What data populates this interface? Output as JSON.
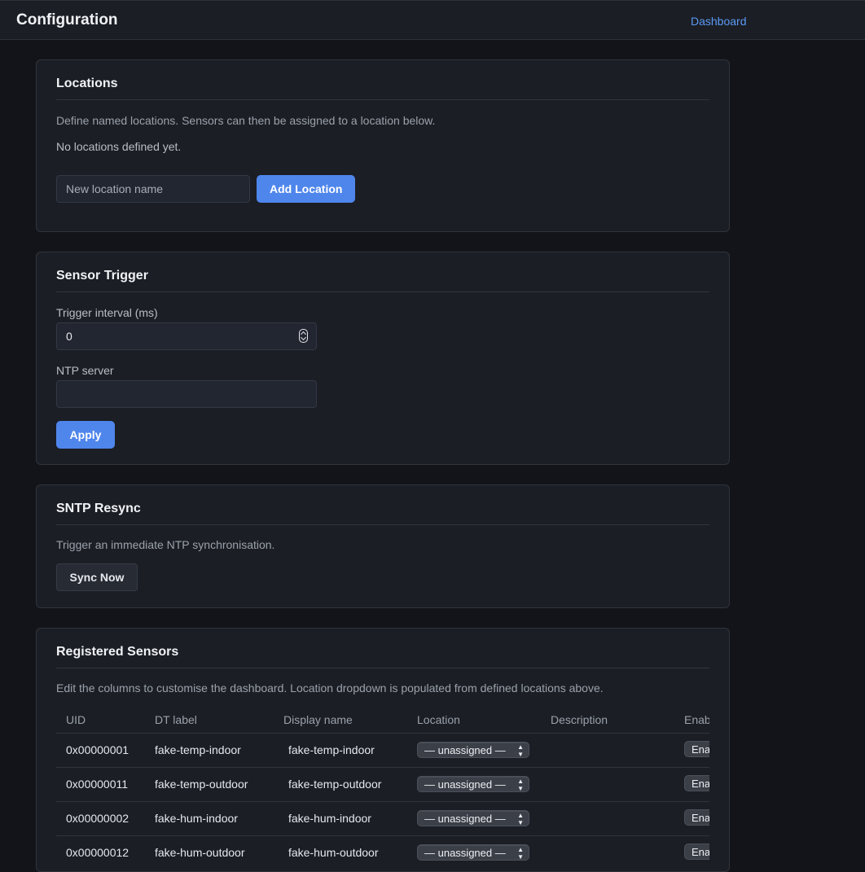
{
  "header": {
    "title": "Configuration",
    "nav_link": "Dashboard"
  },
  "locations": {
    "title": "Locations",
    "description": "Define named locations. Sensors can then be assigned to a location below.",
    "empty_text": "No locations defined yet.",
    "input_placeholder": "New location name",
    "add_button": "Add Location"
  },
  "sensor_trigger": {
    "title": "Sensor Trigger",
    "interval_label": "Trigger interval (ms)",
    "interval_value": "0",
    "ntp_label": "NTP server",
    "ntp_value": "",
    "apply_button": "Apply"
  },
  "sntp": {
    "title": "SNTP Resync",
    "description": "Trigger an immediate NTP synchronisation.",
    "sync_button": "Sync Now"
  },
  "sensors": {
    "title": "Registered Sensors",
    "description": "Edit the columns to customise the dashboard. Location dropdown is populated from defined locations above.",
    "columns": [
      "UID",
      "DT label",
      "Display name",
      "Location",
      "Description",
      "Enab"
    ],
    "rows": [
      {
        "uid": "0x00000001",
        "dt_label": "fake-temp-indoor",
        "display_name": "fake-temp-indoor",
        "location": "— unassigned —",
        "description": "",
        "enable": "Ena"
      },
      {
        "uid": "0x00000011",
        "dt_label": "fake-temp-outdoor",
        "display_name": "fake-temp-outdoor",
        "location": "— unassigned —",
        "description": "",
        "enable": "Ena"
      },
      {
        "uid": "0x00000002",
        "dt_label": "fake-hum-indoor",
        "display_name": "fake-hum-indoor",
        "location": "— unassigned —",
        "description": "",
        "enable": "Ena"
      },
      {
        "uid": "0x00000012",
        "dt_label": "fake-hum-outdoor",
        "display_name": "fake-hum-outdoor",
        "location": "— unassigned —",
        "description": "",
        "enable": "Ena"
      }
    ]
  }
}
